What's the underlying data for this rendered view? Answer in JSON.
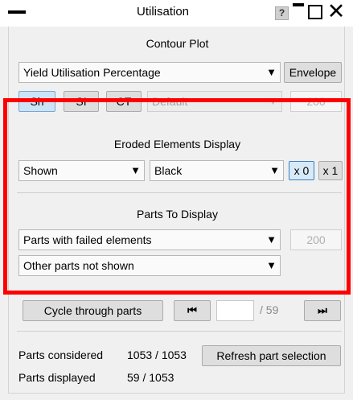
{
  "window": {
    "title": "Utilisation",
    "help_label": "?",
    "close_glyph": "✕"
  },
  "contour": {
    "title": "Contour Plot",
    "type_value": "Yield Utilisation Percentage",
    "envelope_label": "Envelope",
    "mode_buttons": [
      "Sh",
      "SI",
      "CT"
    ],
    "scale_value": "Default",
    "scale_number": "200"
  },
  "eroded": {
    "title": "Eroded Elements Display",
    "display_value": "Shown",
    "colour_value": "Black",
    "factor_buttons": [
      "x 0",
      "x 1"
    ]
  },
  "parts": {
    "title": "Parts To Display",
    "filter_value": "Parts with failed elements",
    "filter_number": "200",
    "other_value": "Other parts not shown"
  },
  "cycle": {
    "button_label": "Cycle through parts",
    "prev_glyph": "⏮",
    "next_glyph": "⏭",
    "current": "",
    "total": "/ 59"
  },
  "stats": {
    "considered_label": "Parts considered",
    "considered_value": "1053 / 1053",
    "refresh_label": "Refresh part selection",
    "displayed_label": "Parts displayed",
    "displayed_value": "59 / 1053"
  },
  "icons": {
    "dropdown_arrow": "▼"
  },
  "colors": {
    "highlight": "#ff0000",
    "active_button": "#cce4f7"
  }
}
